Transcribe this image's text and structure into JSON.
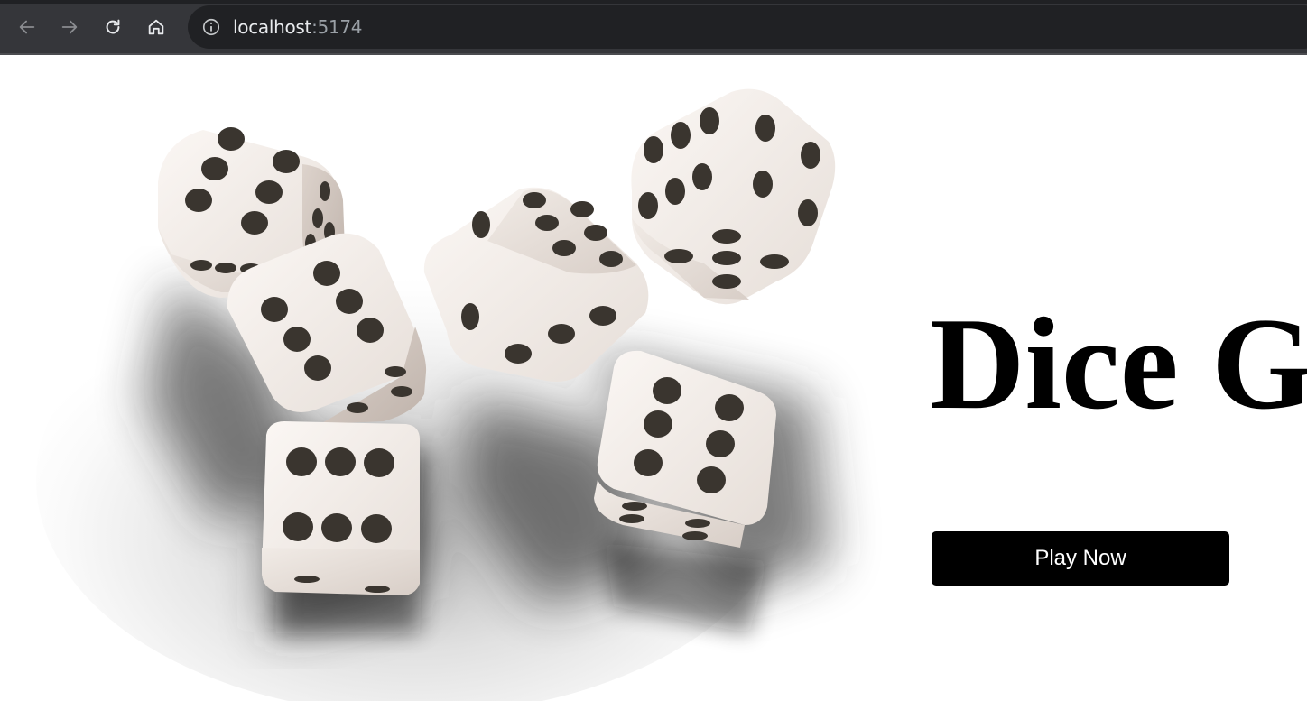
{
  "browser": {
    "url_host": "localhost",
    "url_port": ":5174"
  },
  "page": {
    "title": "Dice G",
    "play_button": "Play Now"
  },
  "colors": {
    "chrome": "#35363a",
    "omnibox": "#202124",
    "button_bg": "#000000",
    "button_text": "#ffffff"
  }
}
